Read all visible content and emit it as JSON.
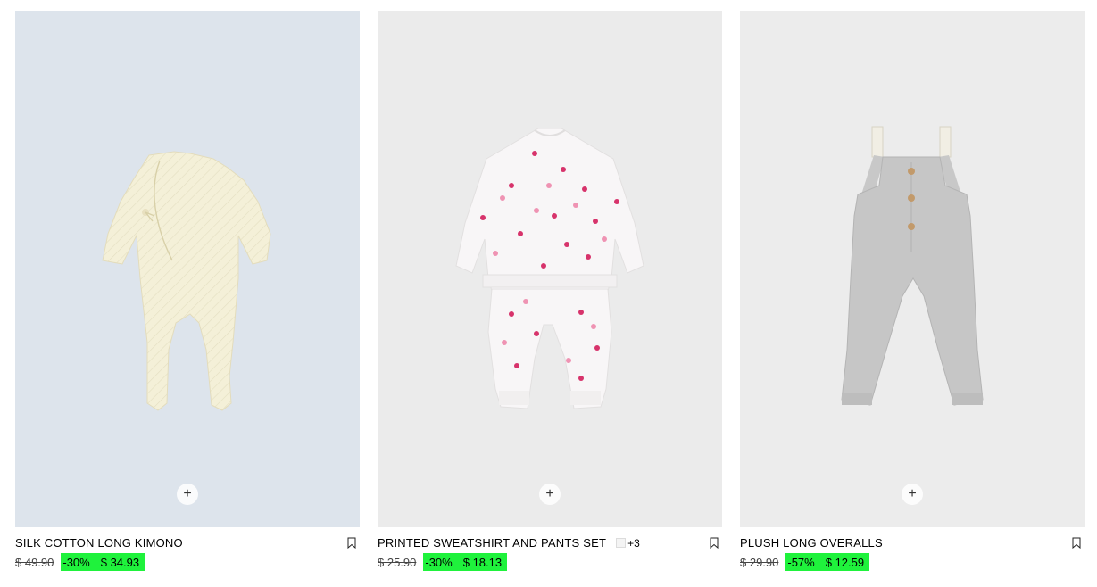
{
  "products": [
    {
      "title": "SILK COTTON LONG KIMONO",
      "old_price": "$ 49.90",
      "discount": "-30%",
      "sale_price": "$ 34.93",
      "more_colors": "",
      "image_bg": "#dde4ec",
      "quick_add_label": "+"
    },
    {
      "title": "PRINTED SWEATSHIRT AND PANTS SET",
      "old_price": "$ 25.90",
      "discount": "-30%",
      "sale_price": "$ 18.13",
      "more_colors": "+3",
      "image_bg": "#ebebeb",
      "quick_add_label": "+"
    },
    {
      "title": "PLUSH LONG OVERALLS",
      "old_price": "$ 29.90",
      "discount": "-57%",
      "sale_price": "$ 12.59",
      "more_colors": "",
      "image_bg": "#ececec",
      "quick_add_label": "+"
    }
  ],
  "colors": {
    "sale_highlight": "#1ff23c"
  },
  "icons": {
    "quick_add": "plus-icon",
    "save": "bookmark-icon"
  }
}
